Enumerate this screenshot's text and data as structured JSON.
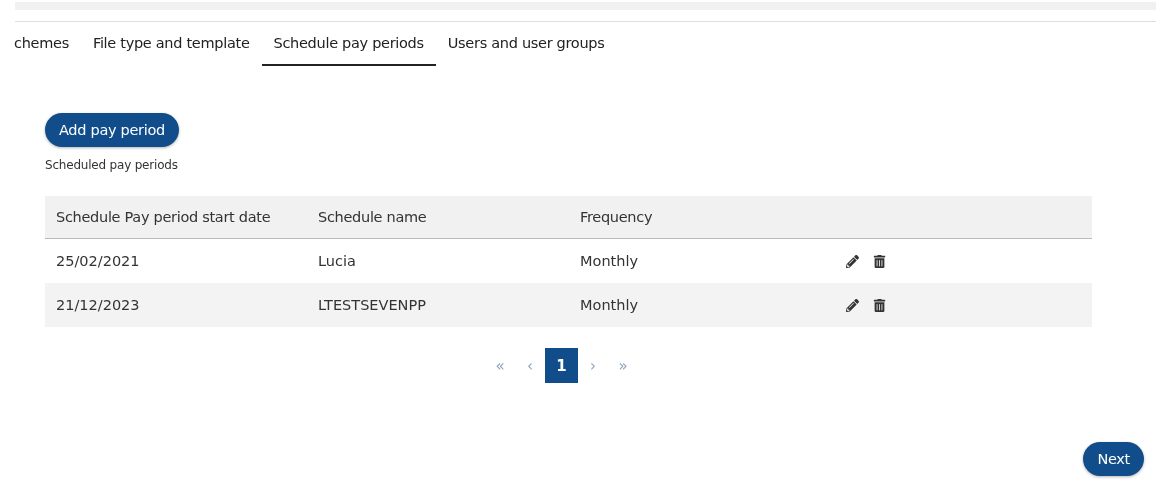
{
  "tabs": [
    {
      "label": "chemes",
      "selected": false
    },
    {
      "label": "File type and template",
      "selected": false
    },
    {
      "label": "Schedule pay periods",
      "selected": true
    },
    {
      "label": "Users and user groups",
      "selected": false
    }
  ],
  "add_button": "Add pay period",
  "table_caption": "Scheduled pay periods",
  "table": {
    "columns": [
      "Schedule Pay period start date",
      "Schedule name",
      "Frequency"
    ],
    "rows": [
      {
        "cells": [
          "25/02/2021",
          "Lucia",
          "Monthly"
        ]
      },
      {
        "cells": [
          "21/12/2023",
          "LTESTSEVENPP",
          "Monthly"
        ]
      }
    ]
  },
  "pagination": {
    "first": "«",
    "prev": "‹",
    "pages": [
      {
        "label": "1",
        "selected": true
      }
    ],
    "next": "›",
    "last": "»"
  },
  "next_button": "Next"
}
